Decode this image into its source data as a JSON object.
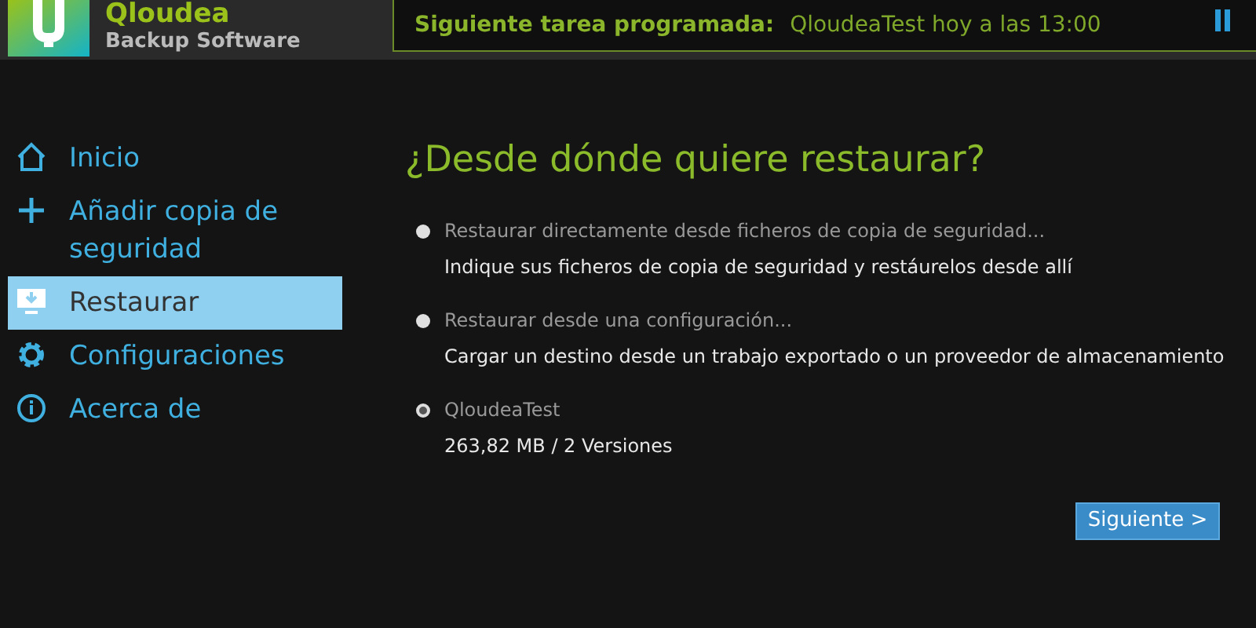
{
  "app": {
    "name": "Qloudea",
    "subtitle": "Backup Software"
  },
  "schedule": {
    "label": "Siguiente tarea programada:",
    "value": "QloudeaTest hoy a las 13:00"
  },
  "sidebar": {
    "items": [
      {
        "kind": "home",
        "label": "Inicio",
        "selected": false
      },
      {
        "kind": "add",
        "label": "Añadir copia de seguridad",
        "selected": false
      },
      {
        "kind": "restore",
        "label": "Restaurar",
        "selected": true
      },
      {
        "kind": "settings",
        "label": "Configuraciones",
        "selected": false
      },
      {
        "kind": "info",
        "label": "Acerca de",
        "selected": false
      }
    ]
  },
  "heading": "¿Desde dónde quiere restaurar?",
  "options": [
    {
      "label": "Restaurar directamente desde ficheros de copia de seguridad...",
      "description": "Indique sus ficheros de copia de seguridad y restáurelos desde allí",
      "selected": false
    },
    {
      "label": "Restaurar desde una configuración...",
      "description": "Cargar un destino desde un trabajo exportado o un proveedor de almacenamiento",
      "selected": false
    },
    {
      "label": "QloudeaTest",
      "description": "263,82 MB / 2 Versiones",
      "selected": true
    }
  ],
  "next_button": "Siguiente >"
}
